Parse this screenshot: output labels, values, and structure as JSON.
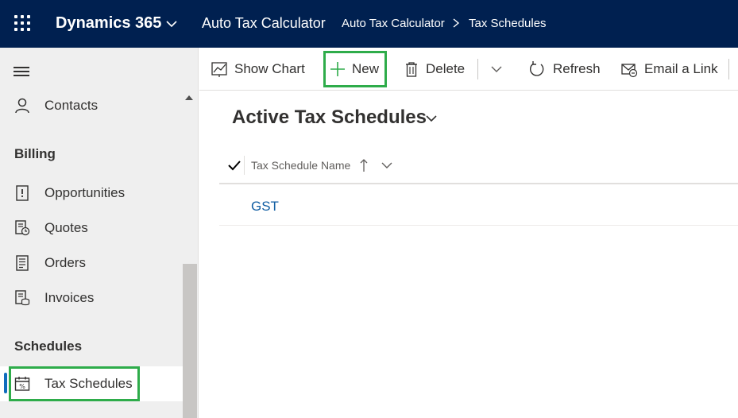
{
  "topbar": {
    "brand": "Dynamics 365",
    "app_name": "Auto Tax Calculator",
    "breadcrumb": [
      "Auto Tax Calculator",
      "Tax Schedules"
    ],
    "background": "#002050"
  },
  "sidebar": {
    "items": [
      {
        "label": "Contacts",
        "icon": "person-icon"
      },
      {
        "label": "Opportunities",
        "icon": "opportunity-icon"
      },
      {
        "label": "Quotes",
        "icon": "quote-icon"
      },
      {
        "label": "Orders",
        "icon": "order-icon"
      },
      {
        "label": "Invoices",
        "icon": "invoice-icon"
      },
      {
        "label": "Tax Schedules",
        "icon": "calendar-percent-icon",
        "selected": true
      }
    ],
    "groups": [
      "Billing",
      "Schedules"
    ]
  },
  "commandbar": {
    "show_chart": "Show Chart",
    "new": "New",
    "delete": "Delete",
    "refresh": "Refresh",
    "email_link": "Email a Link"
  },
  "view": {
    "title": "Active Tax Schedules",
    "column_header": "Tax Schedule Name",
    "rows": [
      {
        "name": "GST"
      }
    ]
  },
  "colors": {
    "highlight": "#2eac4a",
    "link": "#115ea3",
    "selected_indicator": "#0f6cbd"
  }
}
